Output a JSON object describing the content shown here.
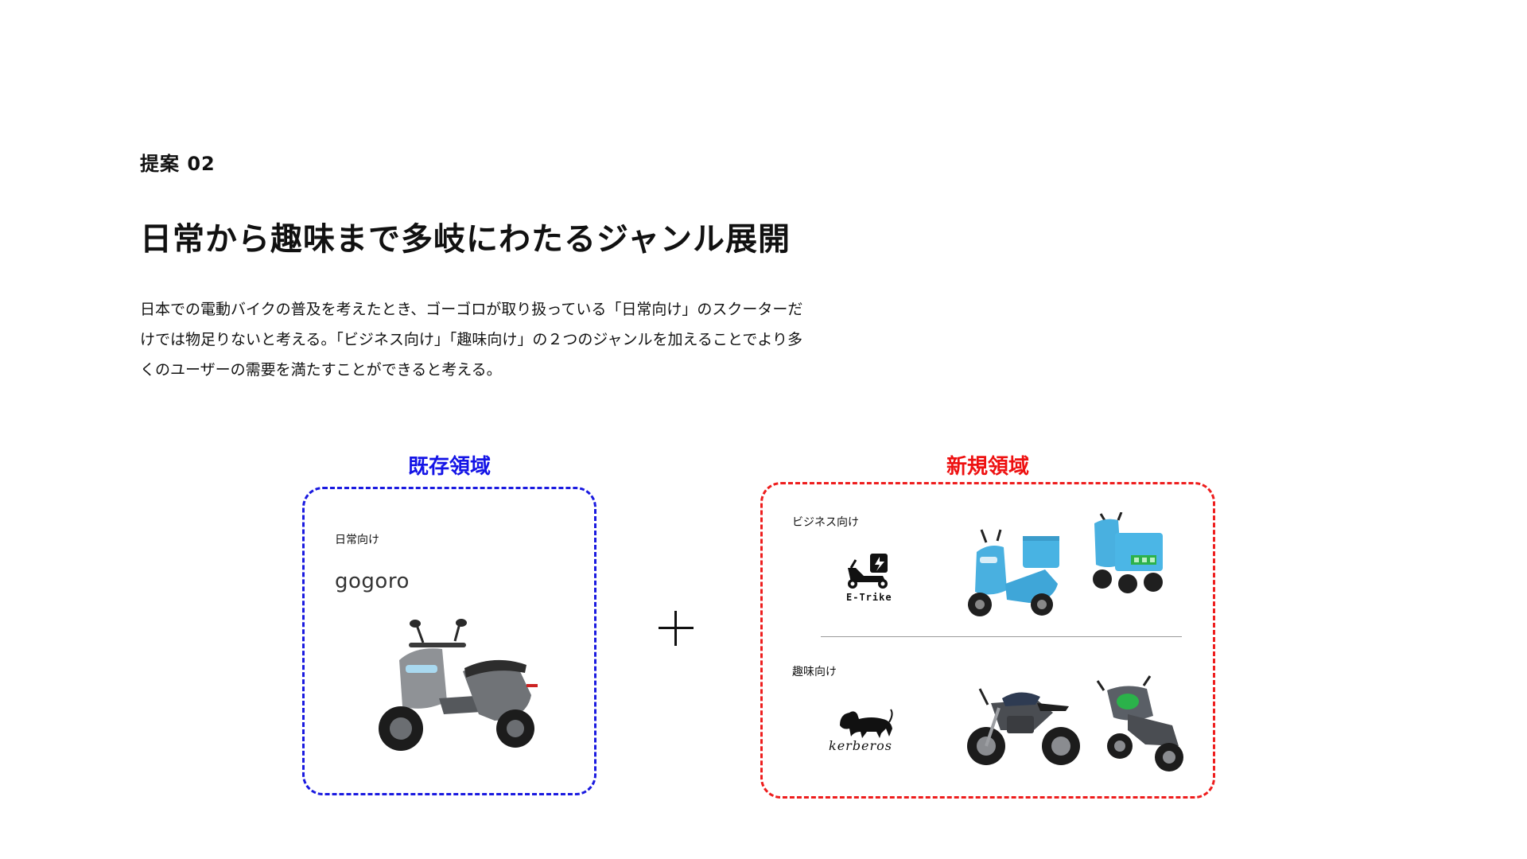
{
  "header": {
    "proposal_label": "提案 02",
    "title": "日常から趣味まで多岐にわたるジャンル展開"
  },
  "body_lines": [
    "日本での電動バイクの普及を考えたとき、ゴーゴロが取り扱っている「日常向け」のスクーターだ",
    "けでは物足りないと考える。「ビジネス向け」「趣味向け」の２つのジャンルを加えることでより多",
    "くのユーザーの需要を満たすことができると考える。"
  ],
  "existing": {
    "title": "既存領域",
    "genre": "日常向け",
    "logo_text": "gogoro",
    "color": "#1a1ae0"
  },
  "new_area": {
    "title": "新規領域",
    "color": "#ee1d1d",
    "business": {
      "genre": "ビジネス向け",
      "logo_text": "E-Trike",
      "vehicle_color": "#3aa9dc"
    },
    "hobby": {
      "genre": "趣味向け",
      "logo_text": "kerberos"
    }
  },
  "icons": {
    "plus": "plus-icon",
    "etrike": "delivery-scooter-icon",
    "kerberos": "lion-emblem-icon"
  }
}
